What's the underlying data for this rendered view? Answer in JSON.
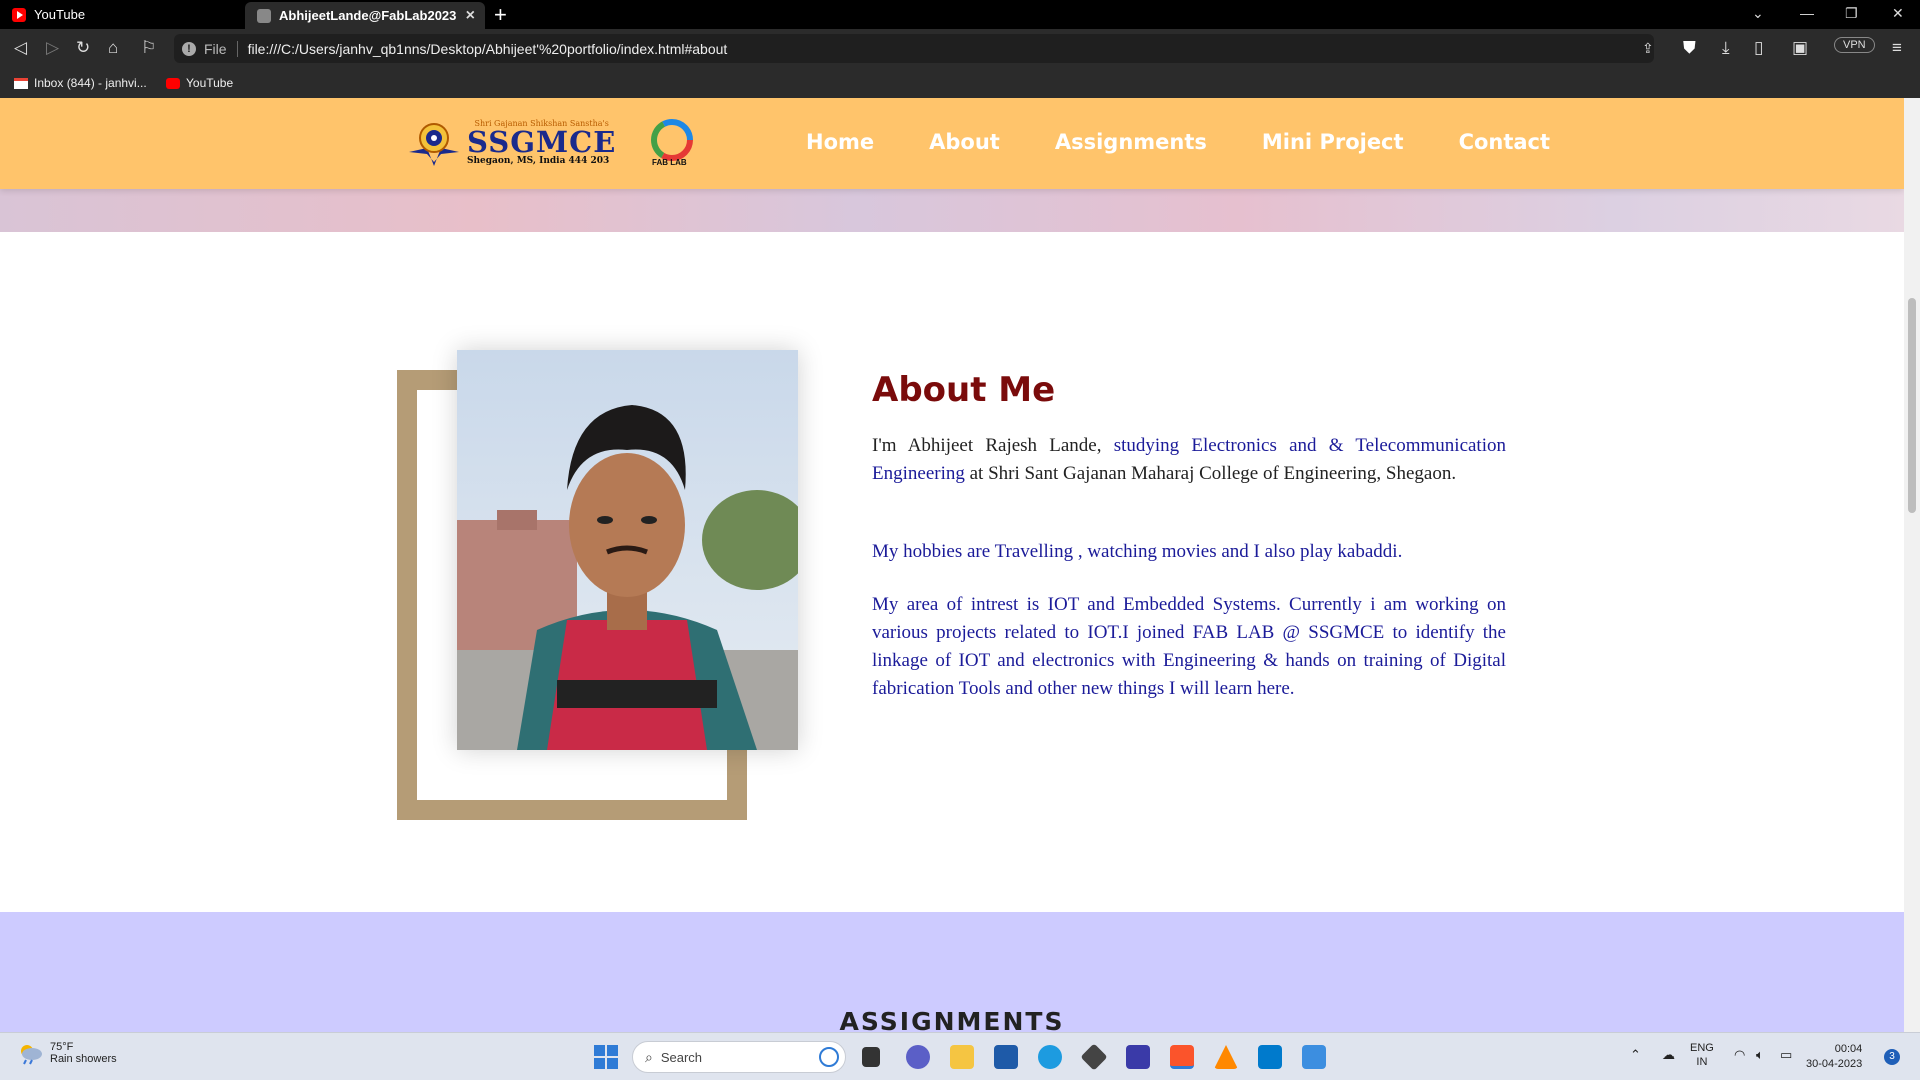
{
  "browser": {
    "tabs": [
      {
        "label": "YouTube",
        "icon": "youtube-icon"
      },
      {
        "label": "AbhijeetLande@FabLab2023",
        "icon": "globe-icon",
        "active": true
      }
    ],
    "url_scheme_label": "File",
    "url": "file:///C:/Users/janhv_qb1nns/Desktop/Abhijeet'%20portfolio/index.html#about",
    "vpn_label": "VPN",
    "bookmarks": [
      {
        "label": "Inbox (844) - janhvi...",
        "icon": "gmail-icon"
      },
      {
        "label": "YouTube",
        "icon": "youtube-icon"
      }
    ]
  },
  "site": {
    "logo": {
      "tagline": "Shri Gajanan Shikshan Sanstha's",
      "name": "SSGMCE",
      "address": "Shegaon, MS, India 444 203",
      "fablab_label": "FAB LAB"
    },
    "nav": [
      "Home",
      "About",
      "Assignments",
      "Mini Project",
      "Contact"
    ],
    "about": {
      "title": "About Me",
      "para1_dark": "I'm Abhijeet Rajesh Lande,",
      "para1_blue": " studying Electronics and & Telecommunication Engineering",
      "para1_dark2": " at Shri Sant Gajanan Maharaj College of Engineering, Shegaon.",
      "para2": "My hobbies are Travelling , watching movies and I also play kabaddi.",
      "para3": "My area of intrest is IOT and Embedded Systems. Currently i am working on various projects related to IOT.I joined FAB LAB @ SSGMCE to identify the linkage of IOT and electronics with Engineering & hands on training of Digital fabrication Tools and other new things I will learn here."
    },
    "assignments_title": "ASSIGNMENTS"
  },
  "taskbar": {
    "weather_temp": "75°F",
    "weather_desc": "Rain showers",
    "search_placeholder": "Search",
    "lang_top": "ENG",
    "lang_bottom": "IN",
    "time": "00:04",
    "date": "30-04-2023",
    "notification_count": "3"
  },
  "colors": {
    "header_bg": "#ffc46b",
    "about_title": "#7a0b0b",
    "body_text": "#1b1b99",
    "frame": "#b59c76",
    "assignments_bg": "#cdcbff"
  }
}
